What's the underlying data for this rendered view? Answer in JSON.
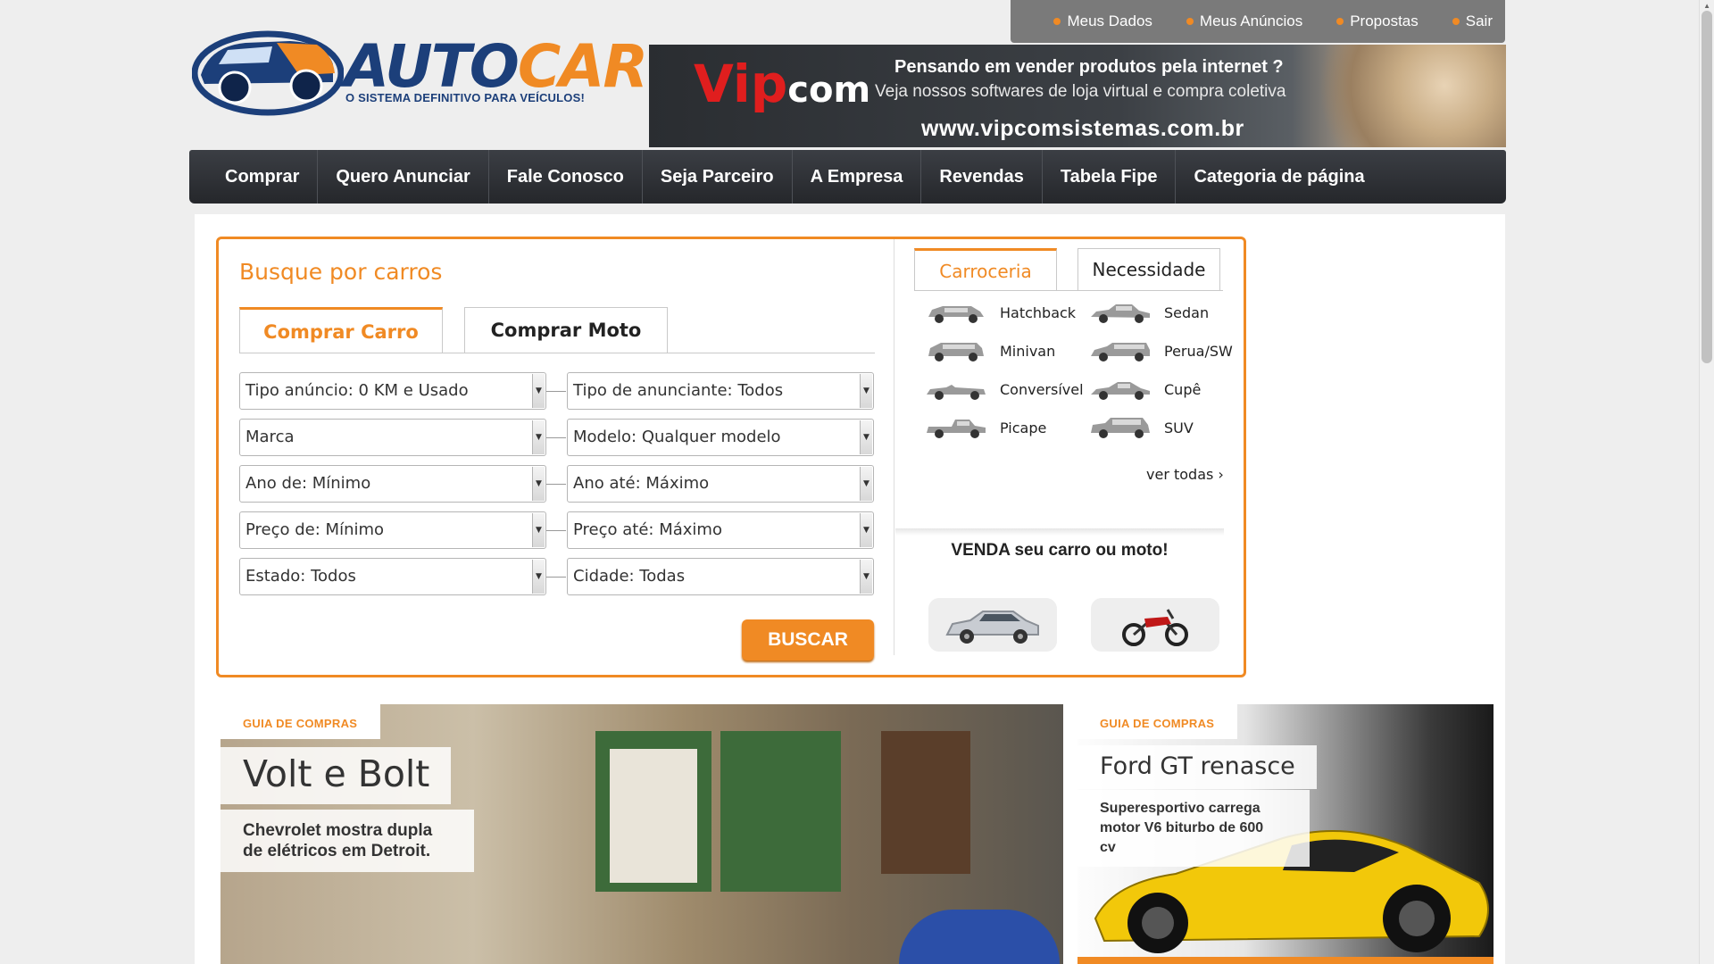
{
  "userbar": {
    "items": [
      "Meus Dados",
      "Meus Anúncios",
      "Propostas",
      "Sair"
    ]
  },
  "logo": {
    "part1": "AUTO",
    "part2": "CAR",
    "tagline": "O SISTEMA DEFINITIVO PARA VEÍCULOS!"
  },
  "banner": {
    "brand_v": "Vip",
    "brand_c": "com",
    "line1": "Pensando em vender produtos pela internet ?",
    "line2": "Veja nossos softwares de loja virtual e compra coletiva",
    "url": "www.vipcomsistemas.com.br"
  },
  "nav": {
    "items": [
      "Comprar",
      "Quero Anunciar",
      "Fale Conosco",
      "Seja Parceiro",
      "A Empresa",
      "Revendas",
      "Tabela Fipe",
      "Categoria de página"
    ]
  },
  "search": {
    "title": "Busque por carros",
    "tabs": [
      "Comprar Carro",
      "Comprar Moto"
    ],
    "fields": {
      "tipo_anuncio": "Tipo anúncio: 0 KM e Usado",
      "tipo_anunciante": "Tipo de anunciante: Todos",
      "marca": "Marca",
      "modelo": "Modelo: Qualquer modelo",
      "ano_de": "Ano de: Mínimo",
      "ano_ate": "Ano até: Máximo",
      "preco_de": "Preço de: Mínimo",
      "preco_ate": "Preço até: Máximo",
      "estado": "Estado: Todos",
      "cidade": "Cidade: Todas"
    },
    "button": "BUSCAR"
  },
  "body_types": {
    "tabs": [
      "Carroceria",
      "Necessidade"
    ],
    "items": [
      "Hatchback",
      "Sedan",
      "Minivan",
      "Perua/SW",
      "Conversível",
      "Cupê",
      "Picape",
      "SUV"
    ],
    "ver_todas": "ver todas ›"
  },
  "venda": {
    "text": "VENDA seu carro ou moto!"
  },
  "cards": [
    {
      "tag": "GUIA DE COMPRAS",
      "title": "Volt e Bolt",
      "subtitle_line1": "Chevrolet mostra dupla",
      "subtitle_line2": "de elétricos em Detroit."
    },
    {
      "tag": "GUIA DE COMPRAS",
      "title": "Ford GT renasce",
      "subtitle_line1": "Superesportivo carrega",
      "subtitle_line2": "motor V6 biturbo de 600",
      "subtitle_line3": "cv"
    }
  ],
  "colors": {
    "accent": "#f08a24",
    "brand_blue": "#1c3f7a",
    "nav_bg": "#2e3136"
  }
}
